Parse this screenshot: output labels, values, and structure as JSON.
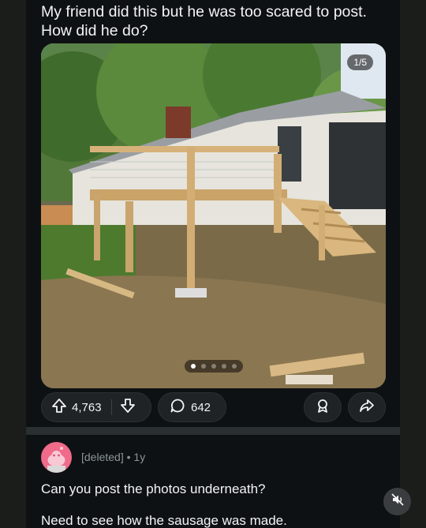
{
  "post": {
    "title": "My friend did this but he was too scared to post. How did he do?",
    "media": {
      "counter": "1/5",
      "slide_count": 5,
      "active_slide": 1
    },
    "actions": {
      "upvotes": "4,763",
      "comments": "642"
    }
  },
  "comment": {
    "author": "[deleted]",
    "separator": "•",
    "age": "1y",
    "lines": [
      "Can you post the photos underneath?",
      "Need to see how the sausage was made."
    ]
  },
  "icons": {
    "upvote": "arrow-up-icon",
    "downvote": "arrow-down-icon",
    "comment": "speech-bubble-icon",
    "award": "award-icon",
    "share": "share-arrow-icon",
    "mute": "speaker-muted-icon",
    "avatar": "snoo-avatar-icon"
  },
  "colors": {
    "background": "#0e1113",
    "pill": "#1f2326",
    "avatar": "#f06a8a",
    "muted_text": "#8b959b"
  }
}
